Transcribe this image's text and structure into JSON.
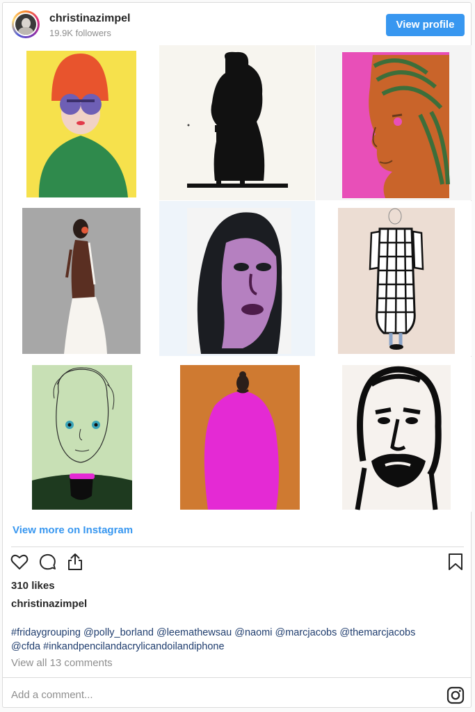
{
  "header": {
    "username": "christinazimpel",
    "followers": "19.9K followers",
    "view_profile_label": "View profile"
  },
  "grid": {
    "images": [
      {
        "name": "orange-hat-woman-artwork",
        "bg": "#f6e14c"
      },
      {
        "name": "black-figure-stool-artwork",
        "bg": "#f7f5ef"
      },
      {
        "name": "magenta-profile-artwork",
        "bg": "#e84fb8"
      },
      {
        "name": "backless-dress-artwork",
        "bg": "#a7a7a7"
      },
      {
        "name": "purple-face-dark-hair-artwork",
        "bg": "#f2f2f4"
      },
      {
        "name": "checkered-dress-artwork",
        "bg": "#ecddd3"
      },
      {
        "name": "green-portrait-artwork",
        "bg": "#c8e0b5"
      },
      {
        "name": "pink-shape-orange-artwork",
        "bg": "#cf7a31"
      },
      {
        "name": "bearded-man-ink-artwork",
        "bg": "#f6f2ee"
      }
    ]
  },
  "links": {
    "view_more": "View more on Instagram"
  },
  "actions": {
    "icons": [
      "heart-icon",
      "comment-icon",
      "share-icon",
      "bookmark-icon"
    ]
  },
  "post": {
    "likes": "310 likes",
    "caption_user": "christinazimpel",
    "hashtags_line1": "#fridaygrouping @polly_borland @leemathewsau @naomi @marcjacobs @themarcjacobs",
    "hashtags_line2": "@cfda #inkandpencilandacrylicandoilandiphone",
    "view_comments": "View all 13 comments"
  },
  "comment_box": {
    "placeholder": "Add a comment..."
  },
  "colors": {
    "accent": "#3897f0",
    "muted": "#8e8e8e",
    "hashtag": "#1f3d6e"
  }
}
